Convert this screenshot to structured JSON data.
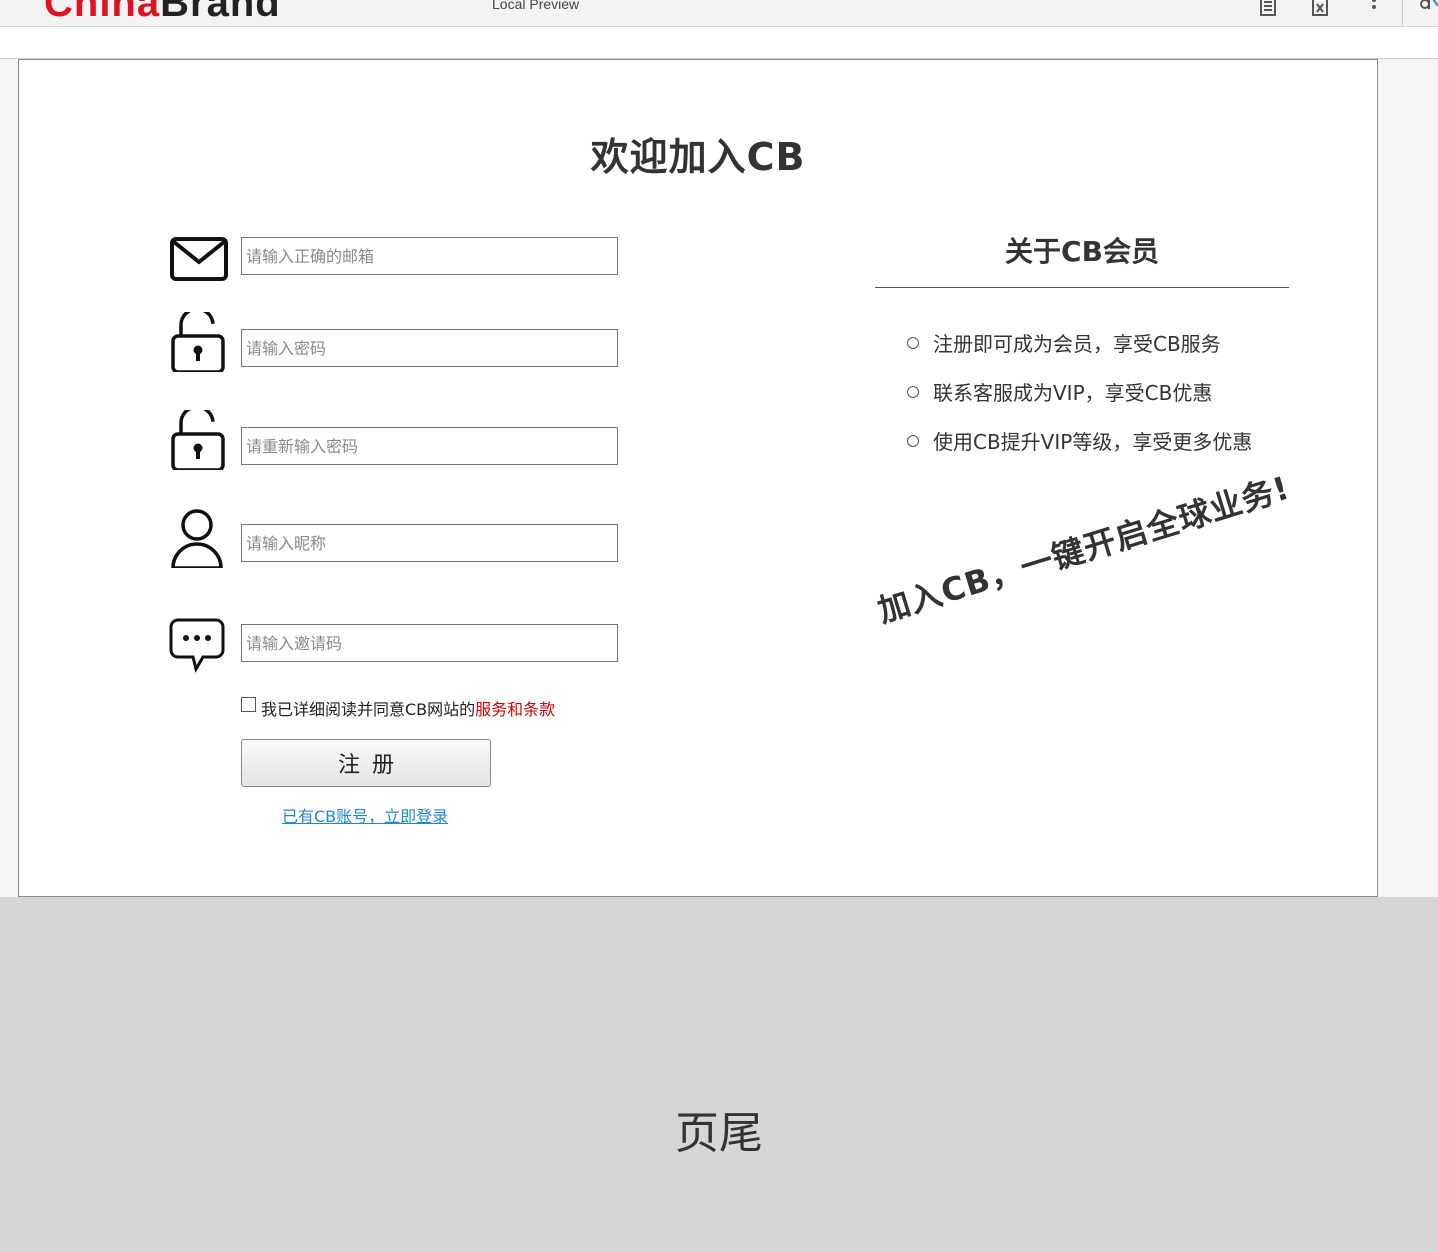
{
  "window": {
    "title": "Local Preview",
    "logo_text_red": "China",
    "logo_text_dark": "Brand"
  },
  "page": {
    "title": "欢迎加入CB"
  },
  "form": {
    "fields": [
      {
        "icon": "mail-icon",
        "placeholder": "请输入正确的邮箱"
      },
      {
        "icon": "lock-icon",
        "placeholder": "请输入密码"
      },
      {
        "icon": "lock-icon",
        "placeholder": "请重新输入密码"
      },
      {
        "icon": "user-icon",
        "placeholder": "请输入昵称"
      },
      {
        "icon": "chat-icon",
        "placeholder": "请输入邀请码"
      }
    ],
    "agree_text": "我已详细阅读并同意CB网站的",
    "agree_terms": "服务和条款",
    "agree_checked": false,
    "register_label": "注册",
    "login_link": "已有CB账号，立即登录"
  },
  "about": {
    "title": "关于CB会员",
    "benefits": [
      "注册即可成为会员，享受CB服务",
      "联系客服成为VIP，享受CB优惠",
      "使用CB提升VIP等级，享受更多优惠"
    ],
    "slogan": "加入CB，一键开启全球业务!"
  },
  "footer": {
    "text": "页尾"
  },
  "colors": {
    "accent_red": "#e00000",
    "link_blue": "#1e88d0",
    "footer_bg": "#d6d6d6"
  }
}
